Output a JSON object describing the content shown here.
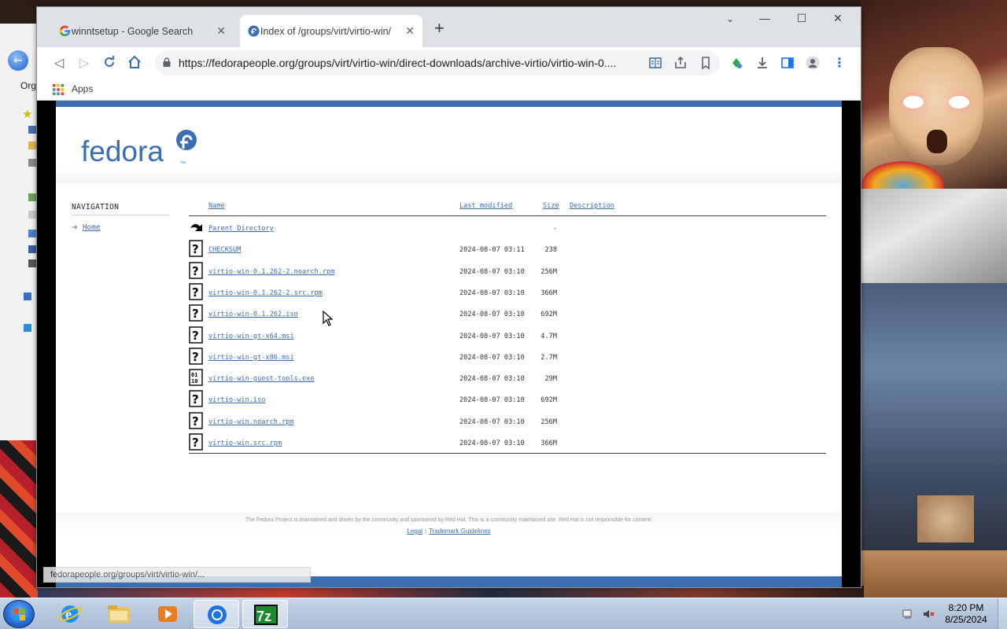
{
  "browser": {
    "tabs": [
      {
        "title": "winntsetup - Google Search",
        "favicon": "google-icon",
        "active": false
      },
      {
        "title": "Index of /groups/virt/virtio-win/",
        "favicon": "fedora-icon",
        "active": true
      }
    ],
    "url": "https://fedorapeople.org/groups/virt/virtio-win/direct-downloads/archive-virtio/virtio-win-0....",
    "bookmarks": {
      "apps_label": "Apps"
    },
    "status_url": "fedorapeople.org/groups/virt/virtio-win/...",
    "accent_color": "#3c6eb4"
  },
  "page": {
    "logo_text": "fedora",
    "logo_tm": "™",
    "navigation": {
      "title": "NAVIGATION",
      "items": [
        {
          "label": "Home"
        }
      ]
    },
    "listing": {
      "headers": {
        "name": "Name",
        "modified": "Last modified",
        "size": "Size",
        "description": "Description"
      },
      "rows": [
        {
          "name": "Parent Directory",
          "modified": "",
          "size": "-",
          "icon": "back-icon"
        },
        {
          "name": "CHECKSUM",
          "modified": "2024-08-07 03:11",
          "size": "238",
          "icon": "unknown-file-icon"
        },
        {
          "name": "virtio-win-0.1.262-2.noarch.rpm",
          "modified": "2024-08-07 03:10",
          "size": "256M",
          "icon": "unknown-file-icon"
        },
        {
          "name": "virtio-win-0.1.262-2.src.rpm",
          "modified": "2024-08-07 03:10",
          "size": "366M",
          "icon": "unknown-file-icon"
        },
        {
          "name": "virtio-win-0.1.262.iso",
          "modified": "2024-08-07 03:10",
          "size": "692M",
          "icon": "unknown-file-icon"
        },
        {
          "name": "virtio-win-gt-x64.msi",
          "modified": "2024-08-07 03:10",
          "size": "4.7M",
          "icon": "unknown-file-icon"
        },
        {
          "name": "virtio-win-gt-x86.msi",
          "modified": "2024-08-07 03:10",
          "size": "2.7M",
          "icon": "unknown-file-icon"
        },
        {
          "name": "virtio-win-guest-tools.exe",
          "modified": "2024-08-07 03:10",
          "size": "29M",
          "icon": "binary-file-icon"
        },
        {
          "name": "virtio-win.iso",
          "modified": "2024-08-07 03:10",
          "size": "692M",
          "icon": "unknown-file-icon"
        },
        {
          "name": "virtio-win.noarch.rpm",
          "modified": "2024-08-07 03:10",
          "size": "256M",
          "icon": "unknown-file-icon"
        },
        {
          "name": "virtio-win.src.rpm",
          "modified": "2024-08-07 03:10",
          "size": "366M",
          "icon": "unknown-file-icon"
        }
      ]
    },
    "footer": {
      "text": "The Fedora Project is maintained and driven by the community and sponsored by Red Hat. This is a community maintained site. Red Hat is not responsible for content.",
      "links": [
        "Legal",
        "Trademark Guidelines"
      ]
    }
  },
  "desktop": {
    "explorer_partial_label": "Org"
  },
  "taskbar": {
    "apps": [
      "start-orb",
      "internet-explorer-icon",
      "file-explorer-icon",
      "media-player-icon",
      "chrome-icon",
      "7zip-icon"
    ],
    "clock_time": "8:20 PM",
    "clock_date": "8/25/2024"
  }
}
